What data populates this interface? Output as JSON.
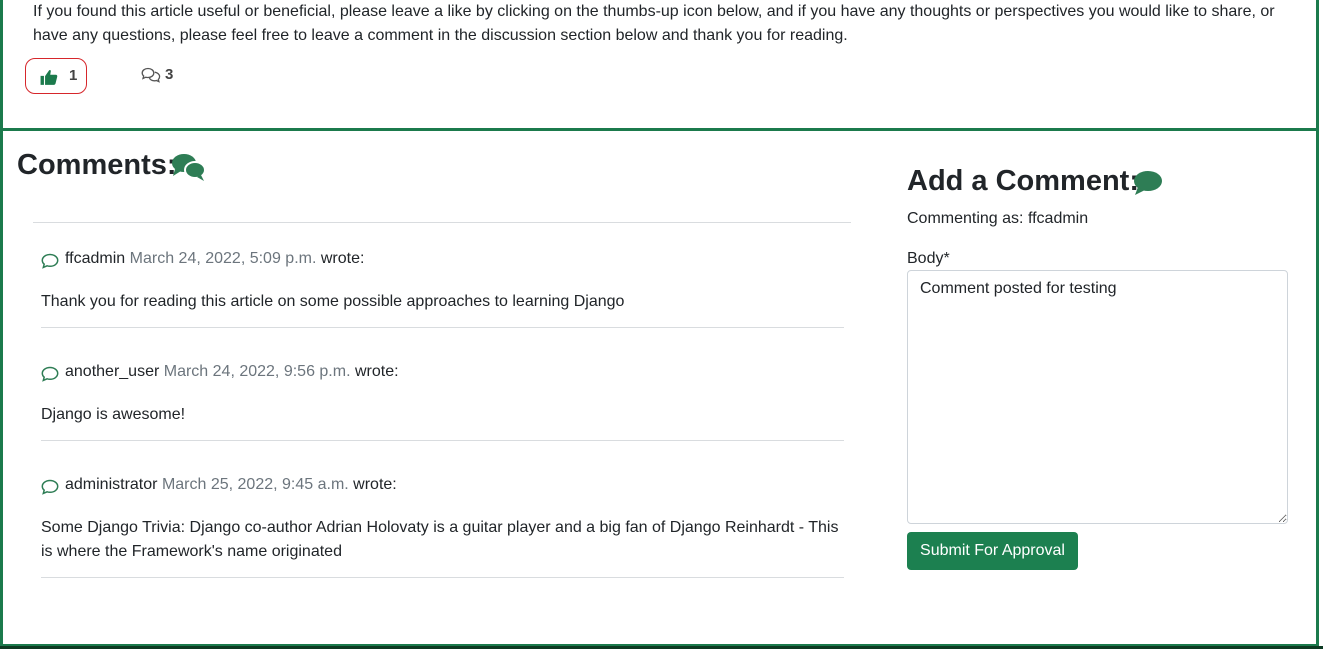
{
  "article": {
    "closing_text": "If you found this article useful or beneficial, please leave a like by clicking on the thumbs-up icon below, and if you have any thoughts or perspectives you would like to share, or have any questions, please feel free to leave a comment in the discussion section below and thank you for reading.",
    "like_count": "1",
    "comment_count": "3",
    "like_icon": "thumbs-up-icon",
    "comment_icon": "comments-outline-icon"
  },
  "comments_section": {
    "title": "Comments:",
    "title_icon": "comments-icon",
    "items": [
      {
        "author": "ffcadmin",
        "date": "March 24, 2022, 5:09 p.m.",
        "wrote": "wrote:",
        "body": "Thank you for reading this article on some possible approaches to learning Django"
      },
      {
        "author": "another_user",
        "date": "March 24, 2022, 9:56 p.m.",
        "wrote": "wrote:",
        "body": "Django is awesome!"
      },
      {
        "author": "administrator",
        "date": "March 25, 2022, 9:45 a.m.",
        "wrote": "wrote:",
        "body": "Some Django Trivia: Django co-author Adrian Holovaty is a guitar player and a big fan of Django Reinhardt - This is where the Framework's name originated"
      }
    ]
  },
  "add_comment": {
    "title": "Add a Comment:",
    "title_icon": "comment-icon",
    "commenting_as": "Commenting as: ffcadmin",
    "body_label": "Body*",
    "body_value": "Comment posted for testing",
    "submit_label": "Submit For Approval"
  },
  "colors": {
    "accent": "#1b7a4c",
    "button": "#1c8050",
    "highlight": "#d6262b"
  }
}
